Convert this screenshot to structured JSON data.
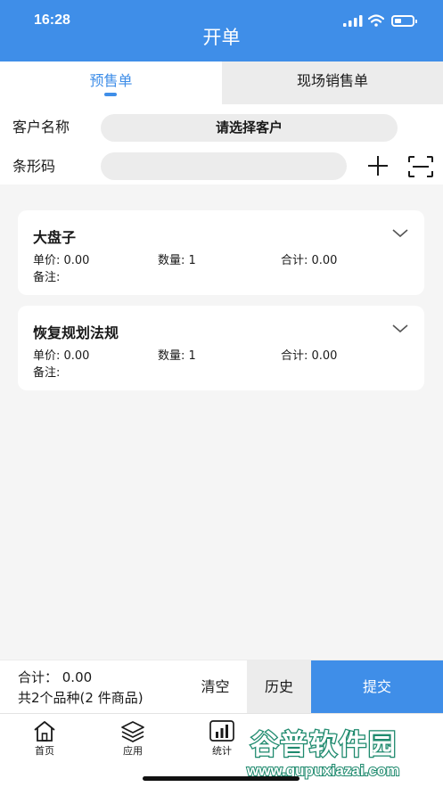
{
  "status_bar": {
    "time": "16:28"
  },
  "header": {
    "title": "开单"
  },
  "tabs": [
    {
      "label": "预售单",
      "active": true
    },
    {
      "label": "现场销售单",
      "active": false
    }
  ],
  "form": {
    "customer_label": "客户名称",
    "customer_select": "请选择客户",
    "barcode_label": "条形码",
    "barcode_value": ""
  },
  "items": [
    {
      "name": "大盘子",
      "price": "单价: 0.00",
      "qty": "数量: 1",
      "total": "合计: 0.00",
      "note": "备注:"
    },
    {
      "name": "恢复规划法规",
      "price": "单价: 0.00",
      "qty": "数量: 1",
      "total": "合计: 0.00",
      "note": "备注:"
    }
  ],
  "footer": {
    "total": "合计： 0.00",
    "count": "共2个品种(2 件商品)",
    "clear_label": "清空",
    "history_label": "历史",
    "submit_label": "提交"
  },
  "bottom_nav": [
    {
      "label": "首页",
      "icon": "home-icon"
    },
    {
      "label": "应用",
      "icon": "layers-icon"
    },
    {
      "label": "统计",
      "icon": "bar-chart-icon"
    }
  ],
  "watermark": {
    "brand": "谷普软件园",
    "url": "www.gupuxiazai.com"
  },
  "colors": {
    "primary": "#3f8ee8",
    "tab_inactive_bg": "#ececec",
    "page_bg": "#f5f5f5",
    "watermark_green": "#1f8a6e"
  }
}
